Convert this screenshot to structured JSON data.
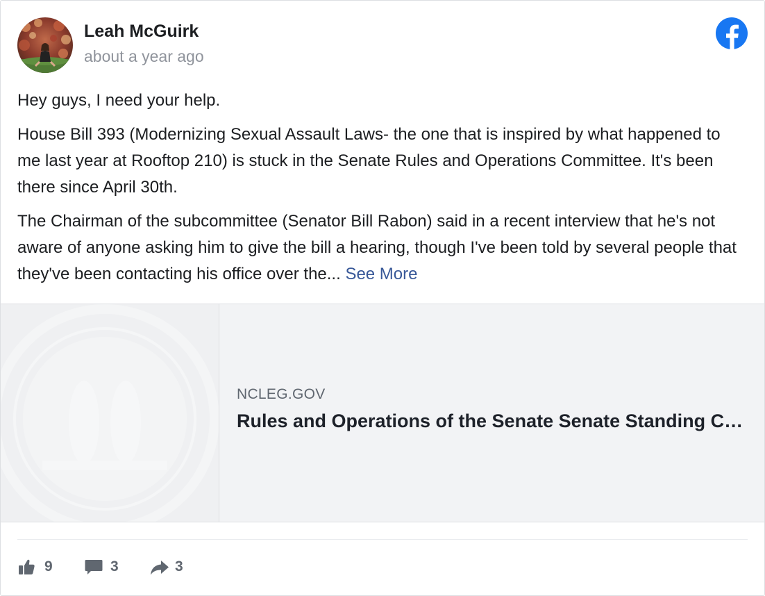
{
  "post": {
    "author": "Leah McGuirk",
    "timestamp": "about a year ago",
    "paragraphs": [
      "Hey guys, I need your help.",
      "House Bill 393 (Modernizing Sexual Assault Laws- the one that is inspired by what happened to me last year at Rooftop 210) is stuck in the Senate Rules and Operations Committee. It's been there since April 30th.",
      "The Chairman of the subcommittee (Senator Bill Rabon) said in a recent interview that he's not aware of anyone asking him to give the bill a hearing, though I've been told by several people that they've been contacting his office over the... "
    ],
    "see_more": "See More"
  },
  "link_preview": {
    "domain": "NCLEG.GOV",
    "title": "Rules and Operations of the Senate Senate Standing Committee"
  },
  "actions": {
    "likes": "9",
    "comments": "3",
    "shares": "3"
  },
  "icons": {
    "platform": "facebook-logo-icon",
    "like": "thumbs-up-icon",
    "comment": "comment-bubble-icon",
    "share": "share-arrow-icon"
  },
  "colors": {
    "facebook_blue": "#1877f2",
    "link_blue": "#385898",
    "muted_text": "#90949c",
    "action_gray": "#606770"
  }
}
